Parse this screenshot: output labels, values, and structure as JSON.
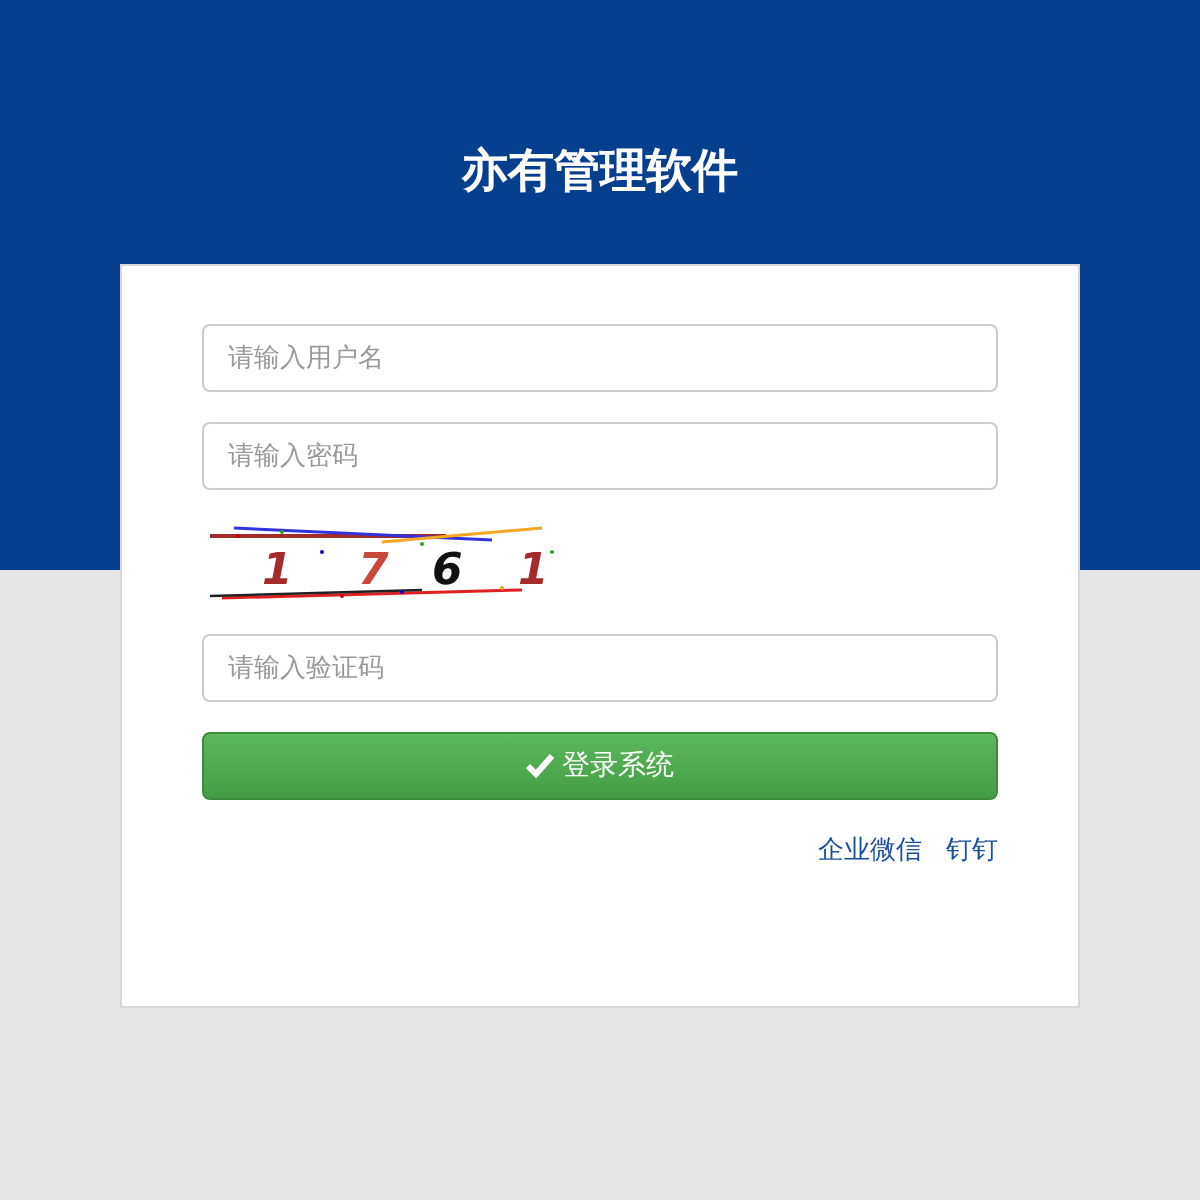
{
  "title": "亦有管理软件",
  "fields": [
    {
      "placeholder": "请输入用户名"
    },
    {
      "placeholder": "请输入密码"
    }
  ],
  "captcha": {
    "chars": [
      "1",
      "7",
      "6",
      "1"
    ]
  },
  "captcha_field": {
    "placeholder": "请输入验证码"
  },
  "login_button": {
    "label": "登录系统"
  },
  "links": [
    "企业微信",
    "钉钉"
  ]
}
